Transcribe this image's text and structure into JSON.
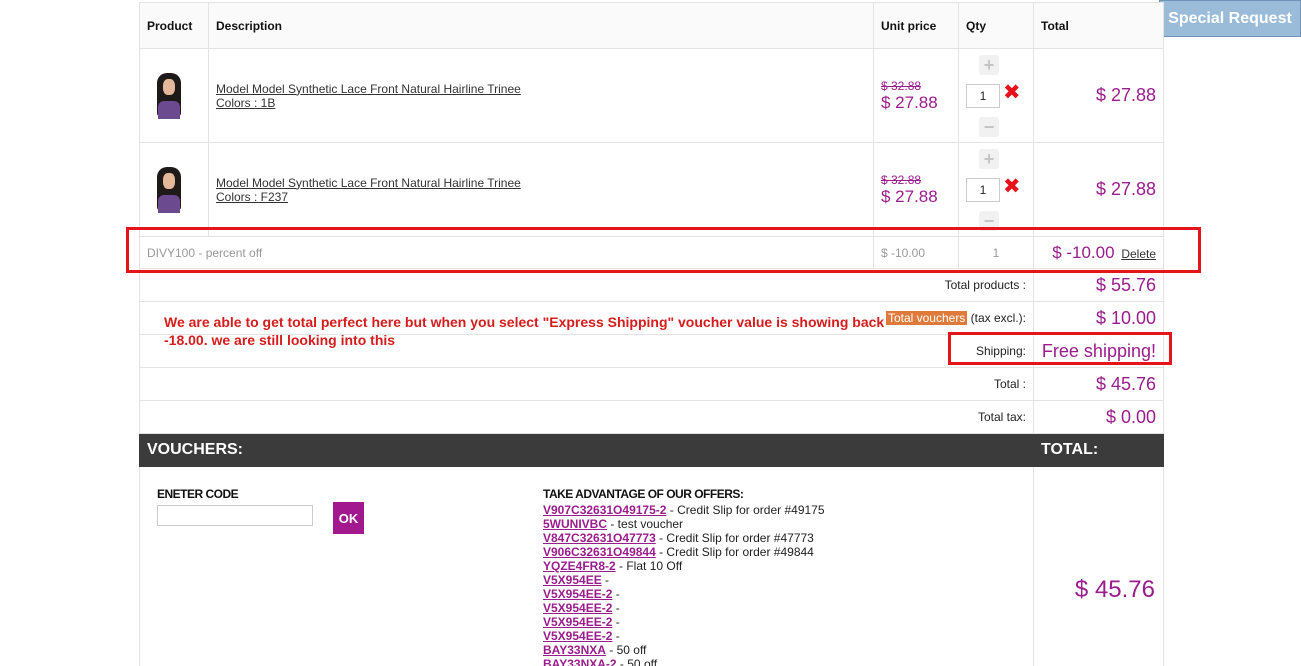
{
  "special_request": "Special Request",
  "headers": {
    "product": "Product",
    "description": "Description",
    "unit_price": "Unit price",
    "qty": "Qty",
    "total": "Total"
  },
  "items": [
    {
      "name": "Model Model Synthetic Lace Front Natural Hairline Trinee",
      "colors": "Colors : 1B",
      "old_price": "$ 32.88",
      "price": "$ 27.88",
      "qty": "1",
      "total": "$ 27.88"
    },
    {
      "name": "Model Model Synthetic Lace Front Natural Hairline Trinee",
      "colors": "Colors : F237",
      "old_price": "$ 32.88",
      "price": "$ 27.88",
      "qty": "1",
      "total": "$ 27.88"
    }
  ],
  "voucher": {
    "name": "DIVY100 - percent off",
    "price": "$ -10.00",
    "qty": "1",
    "total": "$ -10.00",
    "delete": "Delete"
  },
  "summary": {
    "total_products_label": "Total products :",
    "total_products": "$ 55.76",
    "total_vouchers_badge": "Total vouchers",
    "total_vouchers_suffix": " (tax excl.):",
    "total_vouchers": "$ 10.00",
    "shipping_label": "Shipping:",
    "shipping": "Free shipping!",
    "total_label": "Total :",
    "total": "$ 45.76",
    "tax_label": "Total tax:",
    "tax": "$ 0.00"
  },
  "note": "We are able to get total perfect here but when you select \"Express Shipping\" voucher value is showing back -18.00. we are still looking into this",
  "vouchers_header": "VOUCHERS:",
  "total_header": "TOTAL:",
  "enter_code_label": "ENETER CODE",
  "ok_label": "OK",
  "offers_title": "TAKE ADVANTAGE OF OUR OFFERS:",
  "offers": [
    {
      "code": "V907C32631O49175-2",
      "desc": " - Credit Slip for order #49175"
    },
    {
      "code": "5WUNIVBC",
      "desc": " - test voucher"
    },
    {
      "code": "V847C32631O47773",
      "desc": " - Credit Slip for order #47773"
    },
    {
      "code": "V906C32631O49844",
      "desc": " - Credit Slip for order #49844"
    },
    {
      "code": "YQZE4FR8-2",
      "desc": " - Flat 10 Off"
    },
    {
      "code": "V5X954EE",
      "desc": " -"
    },
    {
      "code": "V5X954EE-2",
      "desc": " -"
    },
    {
      "code": "V5X954EE-2",
      "desc": " -"
    },
    {
      "code": "V5X954EE-2",
      "desc": " -"
    },
    {
      "code": "V5X954EE-2",
      "desc": " -"
    },
    {
      "code": "BAY33NXA",
      "desc": " - 50 off"
    },
    {
      "code": "BAY33NXA-2",
      "desc": " - 50 off"
    }
  ],
  "grand_total": "$ 45.76"
}
